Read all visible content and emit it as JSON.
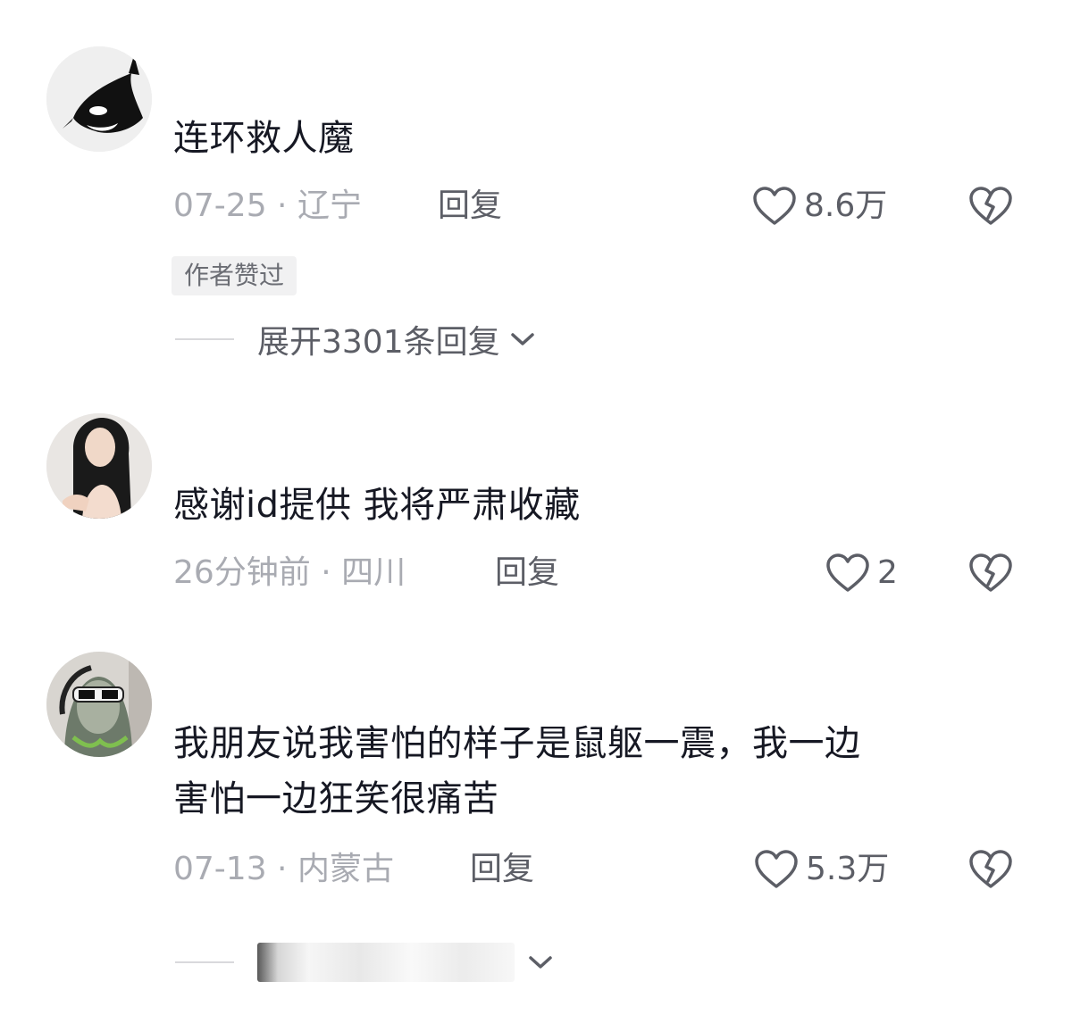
{
  "comments": [
    {
      "avatar": "orca-avatar",
      "text": "连环救人魔",
      "date": "07-25 · 辽宁",
      "reply": "回复",
      "likes": "8.6万",
      "tag": "作者赞过",
      "expand": "展开3301条回复"
    },
    {
      "avatar": "woman-avatar",
      "text": "感谢id提供 我将严肃收藏",
      "date": "26分钟前 · 四川",
      "reply": "回复",
      "likes": "2"
    },
    {
      "avatar": "masked-person-avatar",
      "text_line1": "我朋友说我害怕的样子是鼠躯一震，我一边",
      "text_line2": "害怕一边狂笑很痛苦",
      "date": "07-13 · 内蒙古",
      "reply": "回复",
      "likes": "5.3万"
    }
  ],
  "icons": {
    "like": "heart-outline-icon",
    "dislike": "broken-heart-icon",
    "expand": "chevron-down-icon"
  },
  "colors": {
    "text": "#161823",
    "meta": "#a9abb2",
    "action": "#5c5e66",
    "tag_bg": "#f1f1f2"
  }
}
